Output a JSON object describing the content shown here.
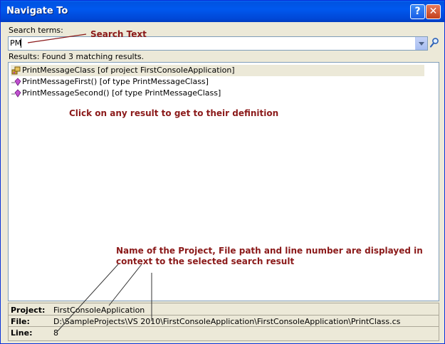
{
  "window": {
    "title": "Navigate To",
    "help_label": "?",
    "close_label": "✕"
  },
  "search": {
    "label": "Search terms:",
    "value": "PM"
  },
  "results": {
    "summary": "Results: Found 3 matching results.",
    "items": [
      {
        "text": "PrintMessageClass [of project FirstConsoleApplication]",
        "icon": "class-icon",
        "selected": true
      },
      {
        "text": "PrintMessageFirst() [of type PrintMessageClass]",
        "icon": "method-icon",
        "selected": false
      },
      {
        "text": "PrintMessageSecond() [of type PrintMessageClass]",
        "icon": "method-icon",
        "selected": false
      }
    ]
  },
  "annotations": {
    "search_text": "Search Text",
    "click_hint": "Click on any result to get to their definition",
    "context_line1": "Name of the Project, File path and line number are displayed in",
    "context_line2": "context to the selected search result"
  },
  "details": {
    "project_label": "Project:",
    "project_value": "FirstConsoleApplication",
    "file_label": "File:",
    "file_value": "D:\\SampleProjects\\VS 2010\\FirstConsoleApplication\\FirstConsoleApplication\\PrintClass.cs",
    "line_label": "Line:",
    "line_value": "8"
  },
  "colors": {
    "title_bar": "#0058ee",
    "annotation": "#8b1a1a",
    "selected_row": "#ece9d8"
  }
}
